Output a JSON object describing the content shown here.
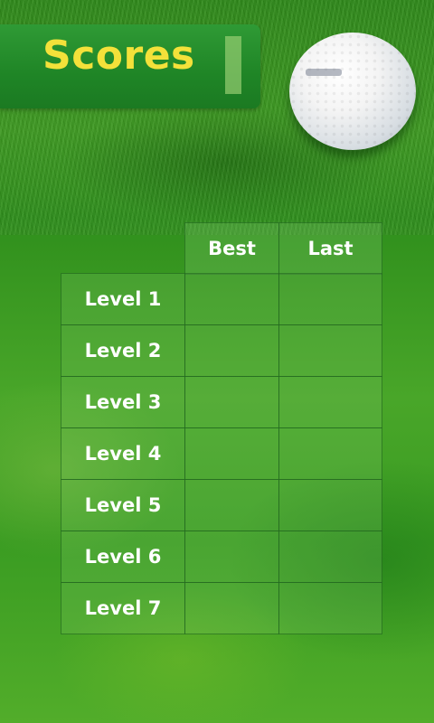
{
  "header": {
    "title": "Scores"
  },
  "scores_table": {
    "columns": [
      "Best",
      "Last"
    ],
    "rows": [
      {
        "label": "Level 1",
        "best": "",
        "last": ""
      },
      {
        "label": "Level 2",
        "best": "",
        "last": ""
      },
      {
        "label": "Level 3",
        "best": "",
        "last": ""
      },
      {
        "label": "Level 4",
        "best": "",
        "last": ""
      },
      {
        "label": "Level 5",
        "best": "",
        "last": ""
      },
      {
        "label": "Level 6",
        "best": "",
        "last": ""
      },
      {
        "label": "Level 7",
        "best": "",
        "last": ""
      }
    ]
  },
  "colors": {
    "title_text": "#f3e13a",
    "panel": "#1f8526",
    "grass": "#3e9a22"
  }
}
